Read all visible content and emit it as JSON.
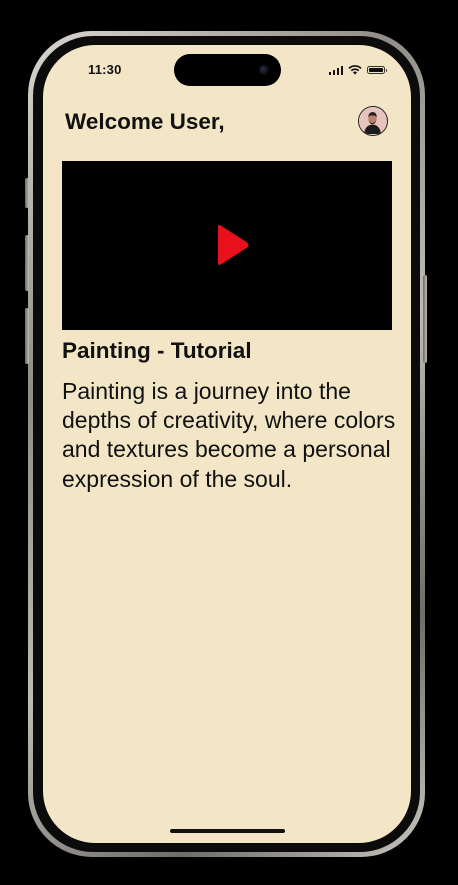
{
  "status_bar": {
    "time": "11:30",
    "icons": [
      "signal-icon",
      "wifi-icon",
      "battery-icon"
    ]
  },
  "header": {
    "greeting": "Welcome User,",
    "avatar_icon": "user-avatar"
  },
  "video": {
    "play_icon": "play-icon",
    "play_color": "#e8101a",
    "background": "#000000"
  },
  "post": {
    "title": "Painting - Tutorial",
    "body": "Painting is a journey into the depths of creativity, where colors and textures become a personal expression of the soul."
  },
  "colors": {
    "screen_background": "#f2e6c6",
    "text": "#111111"
  }
}
